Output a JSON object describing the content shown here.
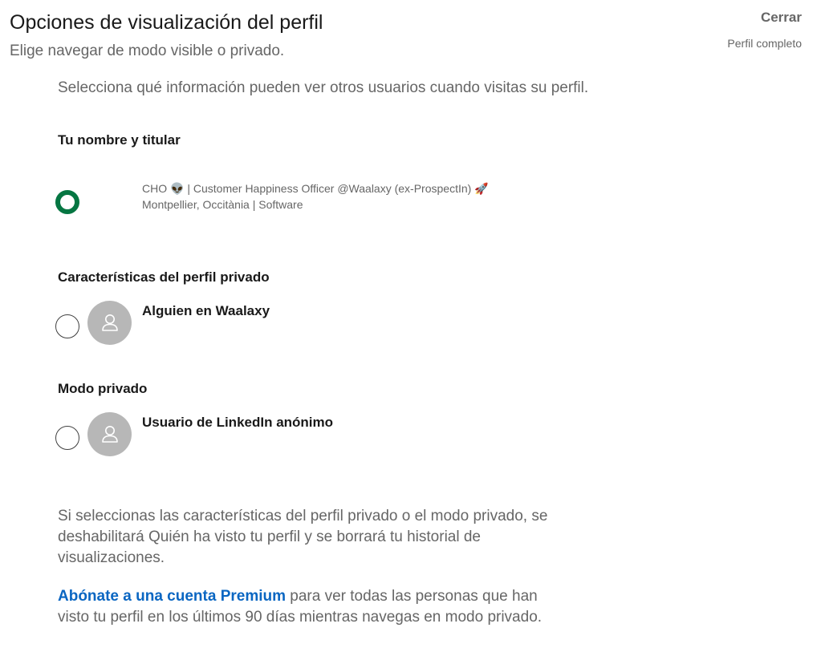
{
  "header": {
    "title": "Opciones de visualización del perfil",
    "subtitle": "Elige navegar de modo visible o privado.",
    "close_label": "Cerrar",
    "full_profile_label": "Perfil completo"
  },
  "intro": "Selecciona qué información pueden ver otros usuarios cuando visitas su perfil.",
  "options": [
    {
      "section_title": "Tu nombre y titular",
      "headline_prefix": "CHO",
      "headline_emoji_1": "👽",
      "headline_text": "| Customer Happiness Officer @Waalaxy (ex-ProspectIn)",
      "headline_emoji_2": "🚀",
      "location": "Montpellier, Occitània | Software",
      "selected": true
    },
    {
      "section_title": "Características del perfil privado",
      "name": "Alguien en Waalaxy",
      "avatar_icon": "ghost-person-icon",
      "selected": false
    },
    {
      "section_title": "Modo privado",
      "name": "Usuario de LinkedIn anónimo",
      "avatar_icon": "ghost-person-icon",
      "selected": false
    }
  ],
  "note": "Si seleccionas las características del perfil privado o el modo privado, se deshabilitará Quién ha visto tu perfil y se borrará tu historial de visualizaciones.",
  "premium": {
    "link_label": "Abónate a una cuenta Premium",
    "text": " para ver todas las personas que han visto tu perfil en los últimos 90 días mientras navegas en modo privado."
  },
  "colors": {
    "selected_radio": "#057642",
    "link": "#0a66c2",
    "avatar_bg": "#b7b7b7"
  }
}
